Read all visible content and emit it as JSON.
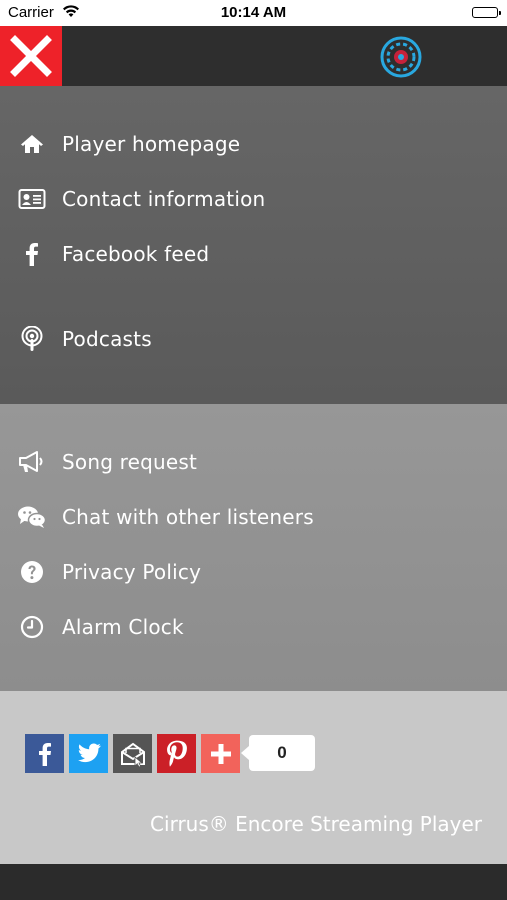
{
  "status_bar": {
    "carrier": "Carrier",
    "time": "10:14 AM",
    "wifi_icon": "wifi-icon",
    "battery_icon": "battery-icon"
  },
  "top_bar": {
    "close_icon": "close-icon",
    "logo_icon": "station-logo-icon",
    "close_color": "#ee2229"
  },
  "menu": {
    "section1": [
      {
        "label": "Player homepage",
        "icon": "home-icon"
      },
      {
        "label": "Contact information",
        "icon": "contact-card-icon"
      },
      {
        "label": "Facebook feed",
        "icon": "facebook-icon"
      },
      {
        "label": "Podcasts",
        "icon": "podcast-icon"
      }
    ],
    "section2": [
      {
        "label": "Song request",
        "icon": "megaphone-icon"
      },
      {
        "label": "Chat with other listeners",
        "icon": "chat-icon"
      },
      {
        "label": "Privacy Policy",
        "icon": "question-icon"
      },
      {
        "label": "Alarm Clock",
        "icon": "clock-icon"
      }
    ]
  },
  "share": {
    "buttons": [
      {
        "name": "facebook",
        "icon": "facebook-share-icon",
        "color": "#3b5998"
      },
      {
        "name": "twitter",
        "icon": "twitter-share-icon",
        "color": "#1da1f2"
      },
      {
        "name": "email",
        "icon": "email-share-icon",
        "color": "#555555"
      },
      {
        "name": "pinterest",
        "icon": "pinterest-share-icon",
        "color": "#cb2027"
      },
      {
        "name": "more",
        "icon": "plus-share-icon",
        "color": "#f2635b"
      }
    ],
    "count": "0"
  },
  "footer": {
    "text": "Cirrus® Encore Streaming Player"
  }
}
